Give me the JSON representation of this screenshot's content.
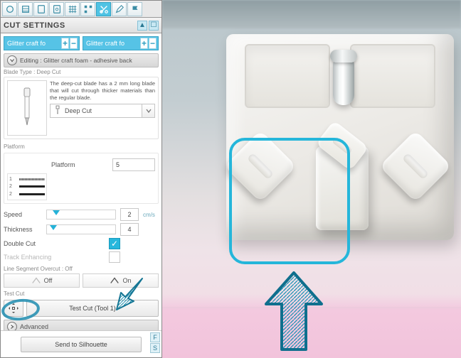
{
  "panel": {
    "title": "CUT SETTINGS",
    "tabs": [
      {
        "label": "Glitter craft fo"
      },
      {
        "label": "Glitter craft fo"
      }
    ],
    "editing_label": "Editing : Glitter craft foam - adhesive back",
    "blade": {
      "section_label": "Blade Type : Deep Cut",
      "description": "The deep-cut blade has a 2 mm long blade that will cut through thicker materials than the regular blade.",
      "dropdown_value": "Deep Cut"
    },
    "platform": {
      "section_label": "Platform",
      "field_label": "Platform",
      "value": "5",
      "rows": [
        "1",
        "2",
        "2"
      ]
    },
    "speed": {
      "label": "Speed",
      "value": "2",
      "unit": "cm/s"
    },
    "thickness": {
      "label": "Thickness",
      "value": "4"
    },
    "double_cut": {
      "label": "Double Cut",
      "checked": true
    },
    "track_enhancing": {
      "label": "Track Enhancing",
      "checked": false
    },
    "overcut": {
      "section_label": "Line Segment Overcut : Off",
      "off": "Off",
      "on": "On"
    },
    "testcut": {
      "section_label": "Test Cut",
      "button": "Test Cut (Tool 1)"
    },
    "advanced": "Advanced",
    "send": "Send to Silhouette"
  },
  "colors": {
    "accent": "#27b7dc"
  }
}
